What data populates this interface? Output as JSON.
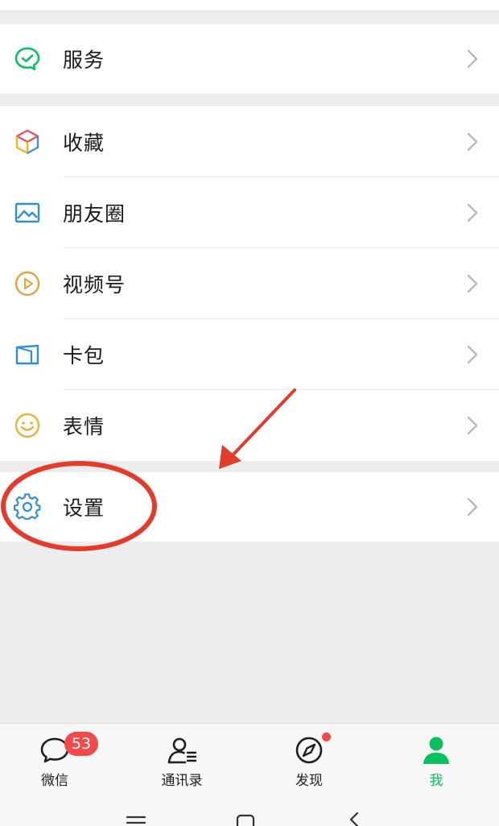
{
  "menu": {
    "service": {
      "label": "服务",
      "icon": "wallet-check-icon"
    },
    "items": [
      {
        "label": "收藏",
        "icon": "cube-icon"
      },
      {
        "label": "朋友圈",
        "icon": "picture-icon"
      },
      {
        "label": "视频号",
        "icon": "play-circle-icon"
      },
      {
        "label": "卡包",
        "icon": "card-icon"
      },
      {
        "label": "表情",
        "icon": "smiley-icon"
      }
    ],
    "settings": {
      "label": "设置",
      "icon": "gear-icon"
    }
  },
  "tabbar": {
    "tabs": [
      {
        "label": "微信",
        "icon": "chat-bubble-icon",
        "badge": "53"
      },
      {
        "label": "通讯录",
        "icon": "contacts-icon"
      },
      {
        "label": "发现",
        "icon": "compass-icon"
      },
      {
        "label": "我",
        "icon": "person-icon",
        "active": true
      }
    ]
  },
  "colors": {
    "brand_green": "#07c160",
    "badge_red": "#f04a4a",
    "annotation_red": "#e53b2a"
  }
}
